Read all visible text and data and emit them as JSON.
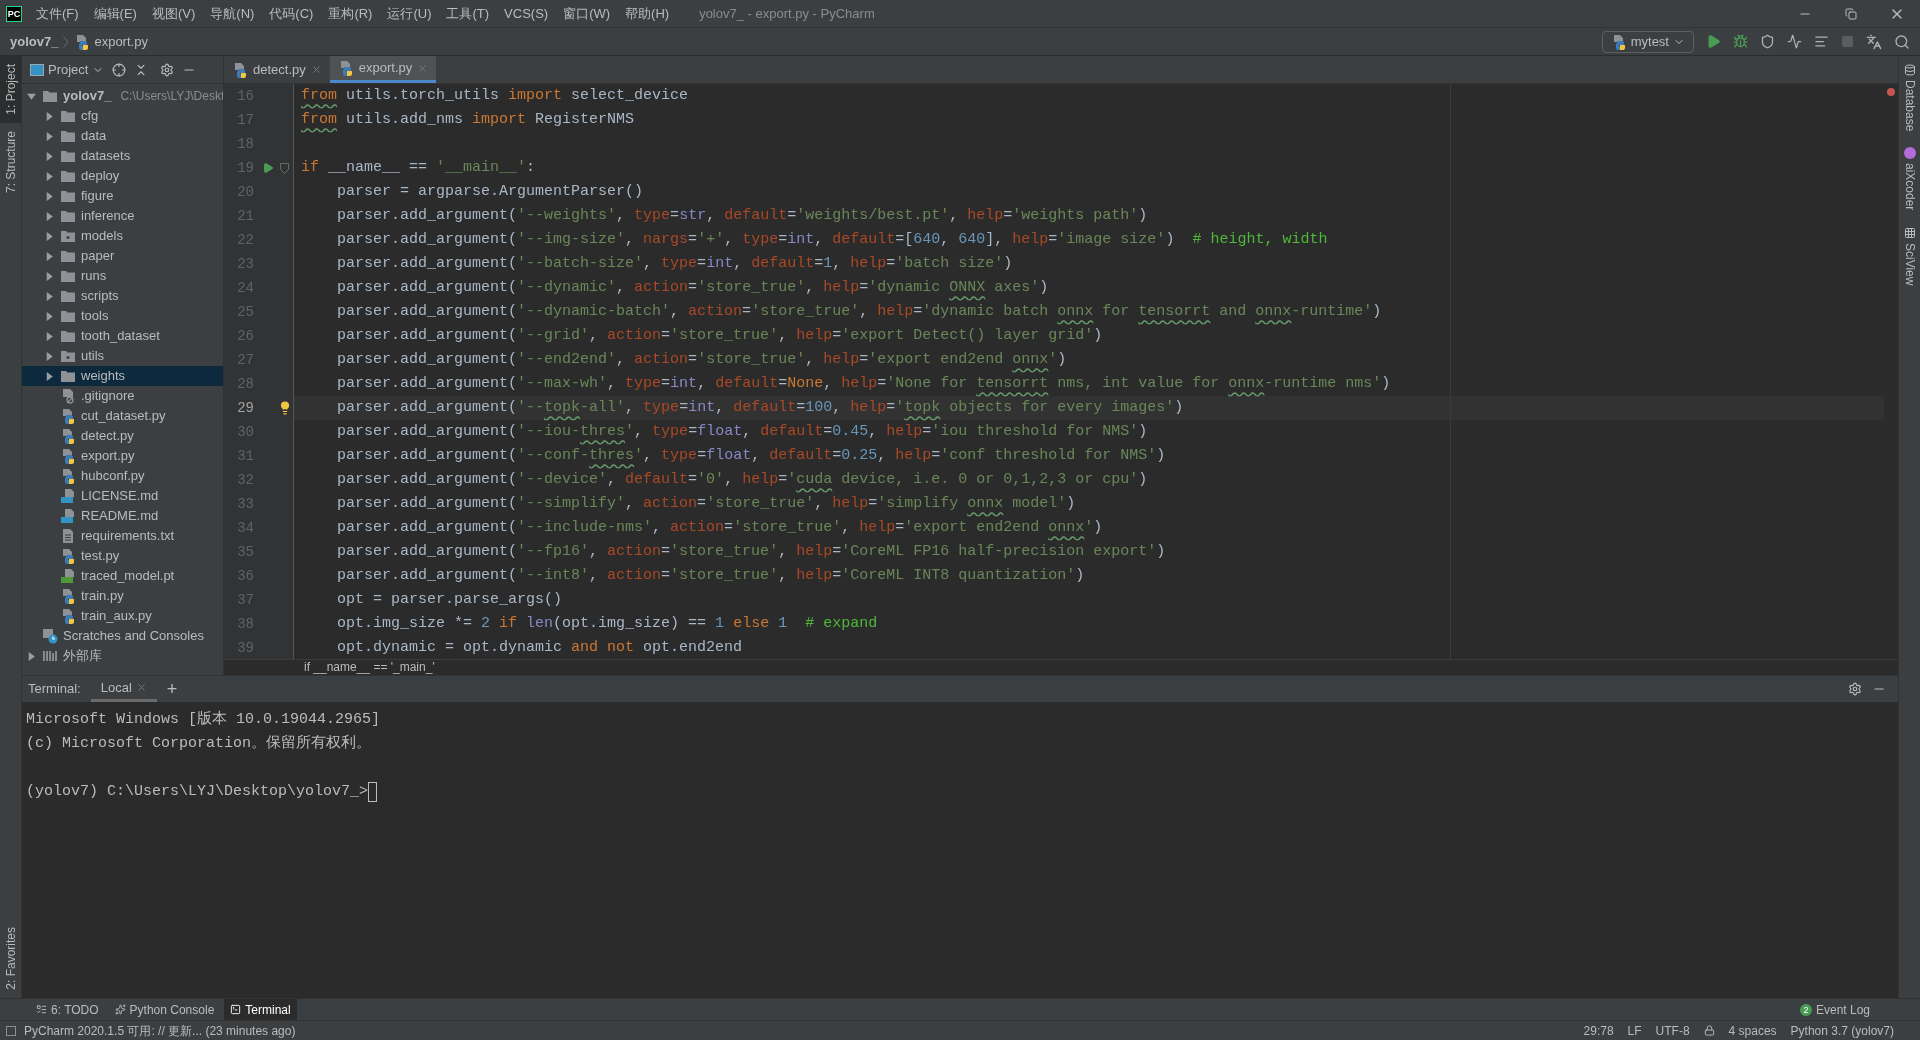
{
  "menu_bar": {
    "logo_text": "PC",
    "menus": [
      "文件(F)",
      "编辑(E)",
      "视图(V)",
      "导航(N)",
      "代码(C)",
      "重构(R)",
      "运行(U)",
      "工具(T)",
      "VCS(S)",
      "窗口(W)",
      "帮助(H)"
    ],
    "title": "yolov7_ - export.py - PyCharm"
  },
  "nav_bar": {
    "crumbs": [
      {
        "label": "yolov7_",
        "kind": "project"
      },
      {
        "label": "export.py",
        "kind": "python"
      }
    ],
    "run_config": "mytest"
  },
  "left_stripe": [
    {
      "label": "1: Project",
      "selected": true
    },
    {
      "label": "7: Structure",
      "selected": false
    }
  ],
  "left_stripe_bottom": [
    {
      "label": "2: Favorites",
      "selected": false
    }
  ],
  "right_stripe": [
    {
      "label": "Database"
    },
    {
      "label": "aiXcoder"
    },
    {
      "label": "SciView"
    }
  ],
  "project": {
    "title": "Project",
    "tree": [
      {
        "name": "yolov7_",
        "hint": "C:\\Users\\LYJ\\Deskt",
        "kind": "folder",
        "expanded": true,
        "selected": false,
        "children": [
          {
            "name": "cfg",
            "kind": "folder",
            "expanded": false,
            "selected": false
          },
          {
            "name": "data",
            "kind": "folder",
            "expanded": false,
            "selected": false
          },
          {
            "name": "datasets",
            "kind": "folder",
            "expanded": false,
            "selected": false
          },
          {
            "name": "deploy",
            "kind": "folder",
            "expanded": false,
            "selected": false
          },
          {
            "name": "figure",
            "kind": "folder",
            "expanded": false,
            "selected": false
          },
          {
            "name": "inference",
            "kind": "folder",
            "expanded": false,
            "selected": false
          },
          {
            "name": "models",
            "kind": "package",
            "expanded": false,
            "selected": false
          },
          {
            "name": "paper",
            "kind": "folder",
            "expanded": false,
            "selected": false
          },
          {
            "name": "runs",
            "kind": "folder",
            "expanded": false,
            "selected": false
          },
          {
            "name": "scripts",
            "kind": "folder",
            "expanded": false,
            "selected": false
          },
          {
            "name": "tools",
            "kind": "folder",
            "expanded": false,
            "selected": false
          },
          {
            "name": "tooth_dataset",
            "kind": "folder",
            "expanded": false,
            "selected": false
          },
          {
            "name": "utils",
            "kind": "package",
            "expanded": false,
            "selected": false
          },
          {
            "name": "weights",
            "kind": "folder",
            "expanded": false,
            "selected": true
          },
          {
            "name": ".gitignore",
            "kind": "ignore",
            "selected": false
          },
          {
            "name": "cut_dataset.py",
            "kind": "python",
            "selected": false
          },
          {
            "name": "detect.py",
            "kind": "python",
            "selected": false
          },
          {
            "name": "export.py",
            "kind": "python",
            "selected": false
          },
          {
            "name": "hubconf.py",
            "kind": "python",
            "selected": false
          },
          {
            "name": "LICENSE.md",
            "kind": "markdown",
            "selected": false
          },
          {
            "name": "README.md",
            "kind": "markdown",
            "selected": false
          },
          {
            "name": "requirements.txt",
            "kind": "text",
            "selected": false
          },
          {
            "name": "test.py",
            "kind": "python",
            "selected": false
          },
          {
            "name": "traced_model.pt",
            "kind": "model",
            "selected": false
          },
          {
            "name": "train.py",
            "kind": "python",
            "selected": false
          },
          {
            "name": "train_aux.py",
            "kind": "python",
            "selected": false
          }
        ]
      },
      {
        "name": "Scratches and Consoles",
        "kind": "scratches",
        "selected": false
      },
      {
        "name": "外部库",
        "kind": "library",
        "expanded": false,
        "selected": false
      }
    ]
  },
  "editor": {
    "tabs": [
      {
        "label": "detect.py",
        "selected": false
      },
      {
        "label": "export.py",
        "selected": true
      }
    ],
    "lines": [
      {
        "number": "16",
        "current": false,
        "tokens": [
          {
            "kind": "kw-typo",
            "text": "from"
          },
          {
            "kind": "plain",
            "text": " utils.torch_utils "
          },
          {
            "kind": "kw",
            "text": "import"
          },
          {
            "kind": "plain",
            "text": " select_device"
          }
        ]
      },
      {
        "number": "17",
        "current": false,
        "tokens": [
          {
            "kind": "kw-typo",
            "text": "from"
          },
          {
            "kind": "plain",
            "text": " utils.add_nms "
          },
          {
            "kind": "kw",
            "text": "import"
          },
          {
            "kind": "plain",
            "text": " RegisterNMS"
          }
        ]
      },
      {
        "number": "18",
        "current": false
      },
      {
        "number": "19",
        "current": false,
        "gutter": {
          "kind": "run"
        },
        "tokens": [
          {
            "kind": "kw",
            "text": "if"
          },
          {
            "kind": "plain",
            "text": " __name__ == "
          },
          {
            "kind": "str",
            "text": "'__main__'"
          },
          {
            "kind": "plain",
            "text": ":"
          }
        ]
      },
      {
        "number": "20",
        "current": false,
        "tokens": [
          {
            "kind": "plain",
            "text": "    parser = argparse.ArgumentParser()"
          }
        ]
      },
      {
        "number": "21",
        "current": false,
        "tokens": [
          {
            "kind": "plain",
            "text": "    parser.add_argument("
          },
          {
            "kind": "str",
            "text": "'--weights'"
          },
          {
            "kind": "plain",
            "text": ", "
          },
          {
            "kind": "arg",
            "text": "type"
          },
          {
            "kind": "plain",
            "text": "="
          },
          {
            "kind": "builtin",
            "text": "str"
          },
          {
            "kind": "plain",
            "text": ", "
          },
          {
            "kind": "arg",
            "text": "default"
          },
          {
            "kind": "plain",
            "text": "="
          },
          {
            "kind": "str",
            "text": "'weights/best.pt'"
          },
          {
            "kind": "plain",
            "text": ", "
          },
          {
            "kind": "arg",
            "text": "help"
          },
          {
            "kind": "plain",
            "text": "="
          },
          {
            "kind": "str",
            "text": "'weights path'"
          },
          {
            "kind": "plain",
            "text": ")"
          }
        ]
      },
      {
        "number": "22",
        "current": false,
        "tokens": [
          {
            "kind": "plain",
            "text": "    parser.add_argument("
          },
          {
            "kind": "str",
            "text": "'--img-size'"
          },
          {
            "kind": "plain",
            "text": ", "
          },
          {
            "kind": "arg",
            "text": "nargs"
          },
          {
            "kind": "plain",
            "text": "="
          },
          {
            "kind": "str",
            "text": "'+'"
          },
          {
            "kind": "plain",
            "text": ", "
          },
          {
            "kind": "arg",
            "text": "type"
          },
          {
            "kind": "plain",
            "text": "="
          },
          {
            "kind": "builtin",
            "text": "int"
          },
          {
            "kind": "plain",
            "text": ", "
          },
          {
            "kind": "arg",
            "text": "default"
          },
          {
            "kind": "plain",
            "text": "=["
          },
          {
            "kind": "num",
            "text": "640"
          },
          {
            "kind": "plain",
            "text": ", "
          },
          {
            "kind": "num",
            "text": "640"
          },
          {
            "kind": "plain",
            "text": "], "
          },
          {
            "kind": "arg",
            "text": "help"
          },
          {
            "kind": "plain",
            "text": "="
          },
          {
            "kind": "str",
            "text": "'image size'"
          },
          {
            "kind": "plain",
            "text": ")  "
          },
          {
            "kind": "comment",
            "text": "# height, width"
          }
        ]
      },
      {
        "number": "23",
        "current": false,
        "tokens": [
          {
            "kind": "plain",
            "text": "    parser.add_argument("
          },
          {
            "kind": "str",
            "text": "'--batch-size'"
          },
          {
            "kind": "plain",
            "text": ", "
          },
          {
            "kind": "arg",
            "text": "type"
          },
          {
            "kind": "plain",
            "text": "="
          },
          {
            "kind": "builtin",
            "text": "int"
          },
          {
            "kind": "plain",
            "text": ", "
          },
          {
            "kind": "arg",
            "text": "default"
          },
          {
            "kind": "plain",
            "text": "="
          },
          {
            "kind": "num",
            "text": "1"
          },
          {
            "kind": "plain",
            "text": ", "
          },
          {
            "kind": "arg",
            "text": "help"
          },
          {
            "kind": "plain",
            "text": "="
          },
          {
            "kind": "str",
            "text": "'batch size'"
          },
          {
            "kind": "plain",
            "text": ")"
          }
        ]
      },
      {
        "number": "24",
        "current": false,
        "tokens": [
          {
            "kind": "plain",
            "text": "    parser.add_argument("
          },
          {
            "kind": "str",
            "text": "'--dynamic'"
          },
          {
            "kind": "plain",
            "text": ", "
          },
          {
            "kind": "arg",
            "text": "action"
          },
          {
            "kind": "plain",
            "text": "="
          },
          {
            "kind": "str",
            "text": "'store_true'"
          },
          {
            "kind": "plain",
            "text": ", "
          },
          {
            "kind": "arg",
            "text": "help"
          },
          {
            "kind": "plain",
            "text": "="
          },
          {
            "kind": "str",
            "text": "'dynamic "
          },
          {
            "kind": "str-typo",
            "text": "ONNX"
          },
          {
            "kind": "str",
            "text": " axes'"
          },
          {
            "kind": "plain",
            "text": ")"
          }
        ]
      },
      {
        "number": "25",
        "current": false,
        "tokens": [
          {
            "kind": "plain",
            "text": "    parser.add_argument("
          },
          {
            "kind": "str",
            "text": "'--dynamic-batch'"
          },
          {
            "kind": "plain",
            "text": ", "
          },
          {
            "kind": "arg",
            "text": "action"
          },
          {
            "kind": "plain",
            "text": "="
          },
          {
            "kind": "str",
            "text": "'store_true'"
          },
          {
            "kind": "plain",
            "text": ", "
          },
          {
            "kind": "arg",
            "text": "help"
          },
          {
            "kind": "plain",
            "text": "="
          },
          {
            "kind": "str",
            "text": "'dynamic batch "
          },
          {
            "kind": "str-typo",
            "text": "onnx"
          },
          {
            "kind": "str",
            "text": " for "
          },
          {
            "kind": "str-typo",
            "text": "tensorrt"
          },
          {
            "kind": "str",
            "text": " and "
          },
          {
            "kind": "str-typo",
            "text": "onnx"
          },
          {
            "kind": "str",
            "text": "-runtime'"
          },
          {
            "kind": "plain",
            "text": ")"
          }
        ]
      },
      {
        "number": "26",
        "current": false,
        "tokens": [
          {
            "kind": "plain",
            "text": "    parser.add_argument("
          },
          {
            "kind": "str",
            "text": "'--grid'"
          },
          {
            "kind": "plain",
            "text": ", "
          },
          {
            "kind": "arg",
            "text": "action"
          },
          {
            "kind": "plain",
            "text": "="
          },
          {
            "kind": "str",
            "text": "'store_true'"
          },
          {
            "kind": "plain",
            "text": ", "
          },
          {
            "kind": "arg",
            "text": "help"
          },
          {
            "kind": "plain",
            "text": "="
          },
          {
            "kind": "str",
            "text": "'export Detect() layer grid'"
          },
          {
            "kind": "plain",
            "text": ")"
          }
        ]
      },
      {
        "number": "27",
        "current": false,
        "tokens": [
          {
            "kind": "plain",
            "text": "    parser.add_argument("
          },
          {
            "kind": "str",
            "text": "'--end2end'"
          },
          {
            "kind": "plain",
            "text": ", "
          },
          {
            "kind": "arg",
            "text": "action"
          },
          {
            "kind": "plain",
            "text": "="
          },
          {
            "kind": "str",
            "text": "'store_true'"
          },
          {
            "kind": "plain",
            "text": ", "
          },
          {
            "kind": "arg",
            "text": "help"
          },
          {
            "kind": "plain",
            "text": "="
          },
          {
            "kind": "str",
            "text": "'export end2end "
          },
          {
            "kind": "str-typo",
            "text": "onnx"
          },
          {
            "kind": "str",
            "text": "'"
          },
          {
            "kind": "plain",
            "text": ")"
          }
        ]
      },
      {
        "number": "28",
        "current": false,
        "tokens": [
          {
            "kind": "plain",
            "text": "    parser.add_argument("
          },
          {
            "kind": "str",
            "text": "'--max-wh'"
          },
          {
            "kind": "plain",
            "text": ", "
          },
          {
            "kind": "arg",
            "text": "type"
          },
          {
            "kind": "plain",
            "text": "="
          },
          {
            "kind": "builtin",
            "text": "int"
          },
          {
            "kind": "plain",
            "text": ", "
          },
          {
            "kind": "arg",
            "text": "default"
          },
          {
            "kind": "plain",
            "text": "="
          },
          {
            "kind": "kw",
            "text": "None"
          },
          {
            "kind": "plain",
            "text": ", "
          },
          {
            "kind": "arg",
            "text": "help"
          },
          {
            "kind": "plain",
            "text": "="
          },
          {
            "kind": "str",
            "text": "'None for "
          },
          {
            "kind": "str-typo",
            "text": "tensorrt"
          },
          {
            "kind": "str",
            "text": " nms, int value for "
          },
          {
            "kind": "str-typo",
            "text": "onnx"
          },
          {
            "kind": "str",
            "text": "-runtime nms'"
          },
          {
            "kind": "plain",
            "text": ")"
          }
        ]
      },
      {
        "number": "29",
        "current": true,
        "gutter": {
          "kind": "bulb"
        },
        "tokens": [
          {
            "kind": "plain",
            "text": "    parser.add_argument("
          },
          {
            "kind": "str",
            "text": "'--"
          },
          {
            "kind": "str-typo",
            "text": "topk"
          },
          {
            "kind": "str",
            "text": "-all'"
          },
          {
            "kind": "plain",
            "text": ", "
          },
          {
            "kind": "arg",
            "text": "type"
          },
          {
            "kind": "plain",
            "text": "="
          },
          {
            "kind": "builtin",
            "text": "int"
          },
          {
            "kind": "plain",
            "text": ", "
          },
          {
            "kind": "arg",
            "text": "default"
          },
          {
            "kind": "plain",
            "text": "="
          },
          {
            "kind": "num",
            "text": "100"
          },
          {
            "kind": "plain",
            "text": ", "
          },
          {
            "kind": "arg",
            "text": "help"
          },
          {
            "kind": "plain",
            "text": "="
          },
          {
            "kind": "str",
            "text": "'"
          },
          {
            "kind": "str-typo",
            "text": "topk"
          },
          {
            "kind": "str",
            "text": " objects for every images'"
          },
          {
            "kind": "plain",
            "text": ")"
          }
        ]
      },
      {
        "number": "30",
        "current": false,
        "tokens": [
          {
            "kind": "plain",
            "text": "    parser.add_argument("
          },
          {
            "kind": "str",
            "text": "'--iou-"
          },
          {
            "kind": "str-typo",
            "text": "thres"
          },
          {
            "kind": "str",
            "text": "'"
          },
          {
            "kind": "plain",
            "text": ", "
          },
          {
            "kind": "arg",
            "text": "type"
          },
          {
            "kind": "plain",
            "text": "="
          },
          {
            "kind": "builtin",
            "text": "float"
          },
          {
            "kind": "plain",
            "text": ", "
          },
          {
            "kind": "arg",
            "text": "default"
          },
          {
            "kind": "plain",
            "text": "="
          },
          {
            "kind": "num",
            "text": "0.45"
          },
          {
            "kind": "plain",
            "text": ", "
          },
          {
            "kind": "arg",
            "text": "help"
          },
          {
            "kind": "plain",
            "text": "="
          },
          {
            "kind": "str",
            "text": "'iou threshold for NMS'"
          },
          {
            "kind": "plain",
            "text": ")"
          }
        ]
      },
      {
        "number": "31",
        "current": false,
        "tokens": [
          {
            "kind": "plain",
            "text": "    parser.add_argument("
          },
          {
            "kind": "str",
            "text": "'--conf-"
          },
          {
            "kind": "str-typo",
            "text": "thres"
          },
          {
            "kind": "str",
            "text": "'"
          },
          {
            "kind": "plain",
            "text": ", "
          },
          {
            "kind": "arg",
            "text": "type"
          },
          {
            "kind": "plain",
            "text": "="
          },
          {
            "kind": "builtin",
            "text": "float"
          },
          {
            "kind": "plain",
            "text": ", "
          },
          {
            "kind": "arg",
            "text": "default"
          },
          {
            "kind": "plain",
            "text": "="
          },
          {
            "kind": "num",
            "text": "0.25"
          },
          {
            "kind": "plain",
            "text": ", "
          },
          {
            "kind": "arg",
            "text": "help"
          },
          {
            "kind": "plain",
            "text": "="
          },
          {
            "kind": "str",
            "text": "'conf threshold for NMS'"
          },
          {
            "kind": "plain",
            "text": ")"
          }
        ]
      },
      {
        "number": "32",
        "current": false,
        "tokens": [
          {
            "kind": "plain",
            "text": "    parser.add_argument("
          },
          {
            "kind": "str",
            "text": "'--device'"
          },
          {
            "kind": "plain",
            "text": ", "
          },
          {
            "kind": "arg",
            "text": "default"
          },
          {
            "kind": "plain",
            "text": "="
          },
          {
            "kind": "str",
            "text": "'0'"
          },
          {
            "kind": "plain",
            "text": ", "
          },
          {
            "kind": "arg",
            "text": "help"
          },
          {
            "kind": "plain",
            "text": "="
          },
          {
            "kind": "str",
            "text": "'"
          },
          {
            "kind": "str-typo",
            "text": "cuda"
          },
          {
            "kind": "str",
            "text": " device, i.e. 0 or 0,1,2,3 or cpu'"
          },
          {
            "kind": "plain",
            "text": ")"
          }
        ]
      },
      {
        "number": "33",
        "current": false,
        "tokens": [
          {
            "kind": "plain",
            "text": "    parser.add_argument("
          },
          {
            "kind": "str",
            "text": "'--simplify'"
          },
          {
            "kind": "plain",
            "text": ", "
          },
          {
            "kind": "arg",
            "text": "action"
          },
          {
            "kind": "plain",
            "text": "="
          },
          {
            "kind": "str",
            "text": "'store_true'"
          },
          {
            "kind": "plain",
            "text": ", "
          },
          {
            "kind": "arg",
            "text": "help"
          },
          {
            "kind": "plain",
            "text": "="
          },
          {
            "kind": "str",
            "text": "'simplify "
          },
          {
            "kind": "str-typo",
            "text": "onnx"
          },
          {
            "kind": "str",
            "text": " model'"
          },
          {
            "kind": "plain",
            "text": ")"
          }
        ]
      },
      {
        "number": "34",
        "current": false,
        "tokens": [
          {
            "kind": "plain",
            "text": "    parser.add_argument("
          },
          {
            "kind": "str",
            "text": "'--include-nms'"
          },
          {
            "kind": "plain",
            "text": ", "
          },
          {
            "kind": "arg",
            "text": "action"
          },
          {
            "kind": "plain",
            "text": "="
          },
          {
            "kind": "str",
            "text": "'store_true'"
          },
          {
            "kind": "plain",
            "text": ", "
          },
          {
            "kind": "arg",
            "text": "help"
          },
          {
            "kind": "plain",
            "text": "="
          },
          {
            "kind": "str",
            "text": "'export end2end "
          },
          {
            "kind": "str-typo",
            "text": "onnx"
          },
          {
            "kind": "str",
            "text": "'"
          },
          {
            "kind": "plain",
            "text": ")"
          }
        ]
      },
      {
        "number": "35",
        "current": false,
        "tokens": [
          {
            "kind": "plain",
            "text": "    parser.add_argument("
          },
          {
            "kind": "str",
            "text": "'--fp16'"
          },
          {
            "kind": "plain",
            "text": ", "
          },
          {
            "kind": "arg",
            "text": "action"
          },
          {
            "kind": "plain",
            "text": "="
          },
          {
            "kind": "str",
            "text": "'store_true'"
          },
          {
            "kind": "plain",
            "text": ", "
          },
          {
            "kind": "arg",
            "text": "help"
          },
          {
            "kind": "plain",
            "text": "="
          },
          {
            "kind": "str",
            "text": "'CoreML FP16 half-precision export'"
          },
          {
            "kind": "plain",
            "text": ")"
          }
        ]
      },
      {
        "number": "36",
        "current": false,
        "tokens": [
          {
            "kind": "plain",
            "text": "    parser.add_argument("
          },
          {
            "kind": "str",
            "text": "'--int8'"
          },
          {
            "kind": "plain",
            "text": ", "
          },
          {
            "kind": "arg",
            "text": "action"
          },
          {
            "kind": "plain",
            "text": "="
          },
          {
            "kind": "str",
            "text": "'store_true'"
          },
          {
            "kind": "plain",
            "text": ", "
          },
          {
            "kind": "arg",
            "text": "help"
          },
          {
            "kind": "plain",
            "text": "="
          },
          {
            "kind": "str",
            "text": "'CoreML INT8 quantization'"
          },
          {
            "kind": "plain",
            "text": ")"
          }
        ]
      },
      {
        "number": "37",
        "current": false,
        "tokens": [
          {
            "kind": "plain",
            "text": "    opt = parser.parse_args()"
          }
        ]
      },
      {
        "number": "38",
        "current": false,
        "tokens": [
          {
            "kind": "plain",
            "text": "    opt.img_size *= "
          },
          {
            "kind": "num",
            "text": "2"
          },
          {
            "kind": "kw",
            "text": " if "
          },
          {
            "kind": "builtin",
            "text": "len"
          },
          {
            "kind": "plain",
            "text": "(opt.img_size) == "
          },
          {
            "kind": "num",
            "text": "1"
          },
          {
            "kind": "kw",
            "text": " else "
          },
          {
            "kind": "num",
            "text": "1"
          },
          {
            "kind": "comment",
            "text": "  # expand"
          }
        ]
      },
      {
        "number": "39",
        "current": false,
        "tokens": [
          {
            "kind": "plain",
            "text": "    opt.dynamic = opt.dynamic "
          },
          {
            "kind": "kw",
            "text": "and not"
          },
          {
            "kind": "plain",
            "text": " opt.end2end"
          }
        ]
      }
    ],
    "breadcrumb": "if __name__ == '_main_'"
  },
  "terminal": {
    "title": "Terminal:",
    "tabs": [
      {
        "label": "Local",
        "selected": true
      }
    ],
    "add": "+",
    "lines": [
      "Microsoft Windows [版本 10.0.19044.2965]",
      "(c) Microsoft Corporation。保留所有权利。"
    ],
    "prompt": "(yolov7) C:\\Users\\LYJ\\Desktop\\yolov7_>"
  },
  "tool_buttons": [
    {
      "label": "6: TODO",
      "kind": "todo",
      "selected": false
    },
    {
      "label": "Python Console",
      "kind": "console",
      "selected": false
    },
    {
      "label": "Terminal",
      "kind": "terminal",
      "selected": true
    }
  ],
  "event_log": {
    "label": "Event Log",
    "count": "2"
  },
  "status": {
    "message": "PyCharm 2020.1.5 可用: // 更新... (23 minutes ago)",
    "items": [
      "29:78",
      "LF",
      "UTF-8",
      "4 spaces",
      "Python 3.7 (yolov7)"
    ]
  }
}
